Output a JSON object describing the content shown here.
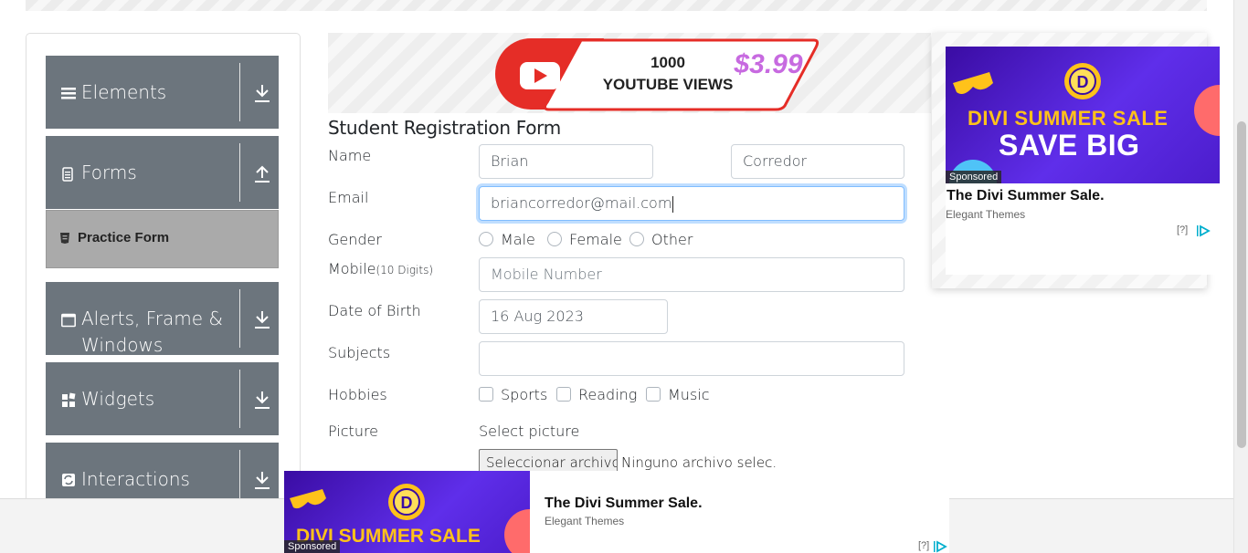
{
  "sidebar": {
    "groups": [
      {
        "label": "Elements"
      },
      {
        "label": "Forms"
      },
      {
        "label": "Alerts, Frame & Windows"
      },
      {
        "label": "Widgets"
      },
      {
        "label": "Interactions"
      }
    ],
    "active_item": "Practice Form"
  },
  "top_ad": {
    "line1": "1000",
    "line2": "YOUTUBE VIEWS",
    "price": "$3.99"
  },
  "form": {
    "title": "Student Registration Form",
    "name_label": "Name",
    "first_name": "Brian",
    "last_name": "Corredor",
    "email_label": "Email",
    "email": "briancorredor@mail.com",
    "gender_label": "Gender",
    "gender_options": [
      "Male",
      "Female",
      "Other"
    ],
    "mobile_label": "Mobile",
    "mobile_hint": "(10 Digits)",
    "mobile_placeholder": "Mobile Number",
    "dob_label": "Date of Birth",
    "dob": "16 Aug 2023",
    "subjects_label": "Subjects",
    "hobbies_label": "Hobbies",
    "hobbies_options": [
      "Sports",
      "Reading",
      "Music"
    ],
    "picture_label": "Picture",
    "select_picture": "Select picture",
    "file_button": "Seleccionar archivo",
    "file_status": "Ninguno archivo selec."
  },
  "ads": {
    "sale_line1": "DIVI SUMMER SALE",
    "sale_line2": "SAVE BIG",
    "sponsored": "Sponsored",
    "headline": "The Divi Summer Sale.",
    "advertiser": "Elegant Themes",
    "info": "[?]"
  },
  "colors": {
    "sidebar_header": "#6c757d",
    "active_item": "#aaaaaa",
    "focus_border": "#80bdff",
    "ad_purple": "#5f2eea",
    "ad_yellow": "#ffc21a"
  }
}
